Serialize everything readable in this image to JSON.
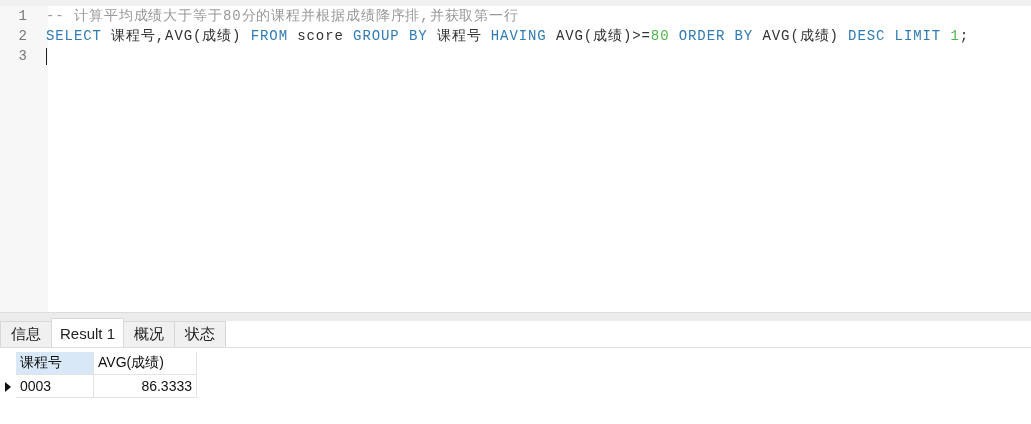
{
  "editor": {
    "lines": [
      {
        "number": "1",
        "tokens": [
          {
            "kind": "comment",
            "text": "-- 计算平均成绩大于等于80分的课程并根据成绩降序排,并获取第一行"
          }
        ]
      },
      {
        "number": "2",
        "tokens": [
          {
            "kind": "keyword",
            "text": "SELECT"
          },
          {
            "kind": "plain",
            "text": " 课程号,AVG(成绩) "
          },
          {
            "kind": "keyword",
            "text": "FROM"
          },
          {
            "kind": "plain",
            "text": " score "
          },
          {
            "kind": "keyword",
            "text": "GROUP BY"
          },
          {
            "kind": "plain",
            "text": " 课程号 "
          },
          {
            "kind": "keyword",
            "text": "HAVING"
          },
          {
            "kind": "plain",
            "text": " AVG(成绩)>="
          },
          {
            "kind": "number",
            "text": "80"
          },
          {
            "kind": "keyword",
            "text": " ORDER BY"
          },
          {
            "kind": "plain",
            "text": " AVG(成绩) "
          },
          {
            "kind": "keyword",
            "text": "DESC LIMIT "
          },
          {
            "kind": "number",
            "text": "1"
          },
          {
            "kind": "plain",
            "text": ";"
          }
        ]
      },
      {
        "number": "3",
        "cursor": true
      }
    ]
  },
  "tabs": [
    {
      "label": "信息",
      "selected": false
    },
    {
      "label": "Result 1",
      "selected": true
    },
    {
      "label": "概况",
      "selected": false
    },
    {
      "label": "状态",
      "selected": false
    }
  ],
  "grid": {
    "columns": [
      {
        "label": "课程号",
        "selected": true
      },
      {
        "label": "AVG(成绩)",
        "selected": false
      }
    ],
    "rows": [
      {
        "current": true,
        "cells": [
          "0003",
          "86.3333"
        ]
      }
    ]
  }
}
